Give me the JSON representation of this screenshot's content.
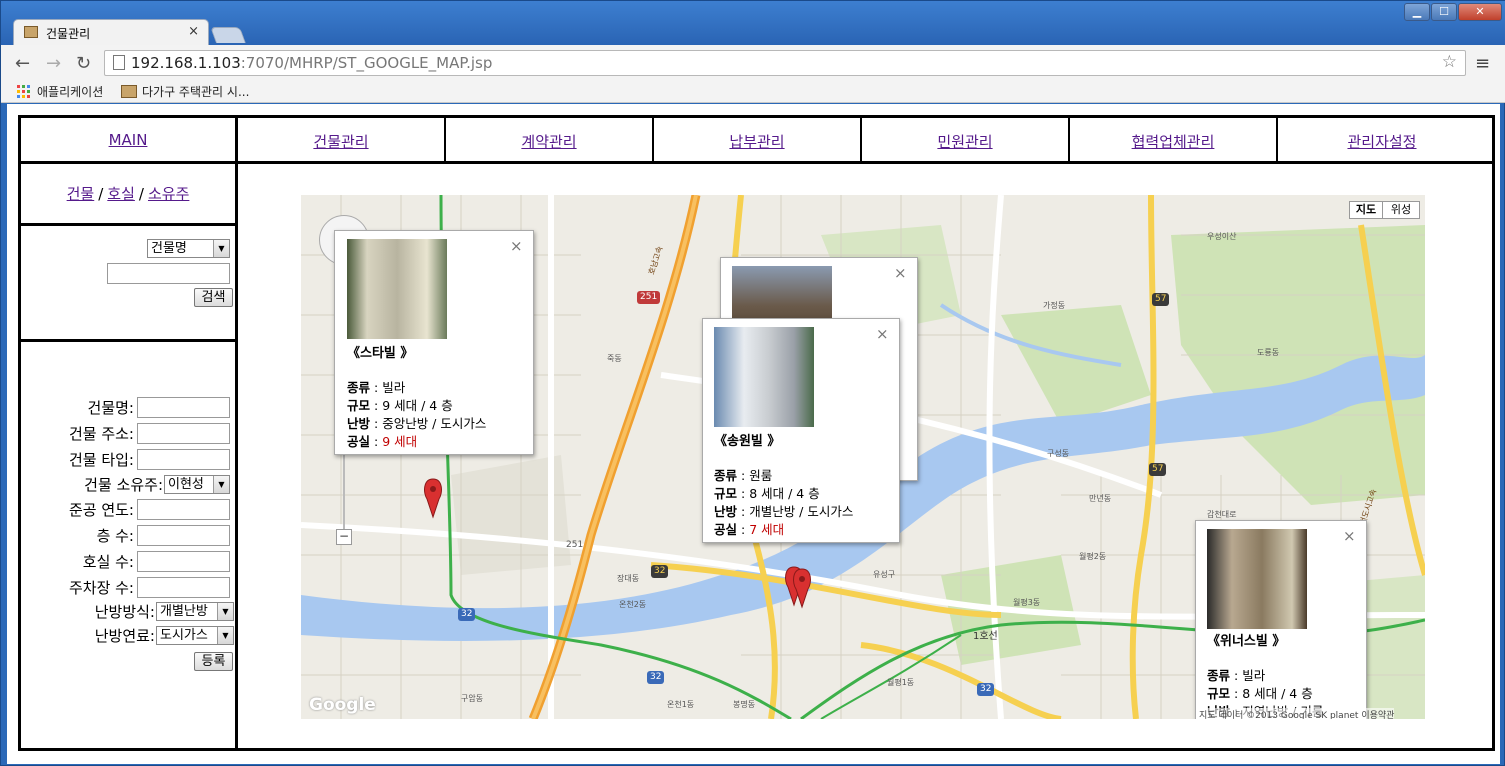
{
  "browser": {
    "tab_title": "건물관리",
    "tab_close": "×",
    "url_host": "192.168.1.103",
    "url_rest": ":7070/MHRP/ST_GOOGLE_MAP.jsp",
    "bookmarks": [
      "애플리케이션",
      "다가구 주택관리 시..."
    ]
  },
  "nav": {
    "main": "MAIN",
    "items": [
      "건물관리",
      "계약관리",
      "납부관리",
      "민원관리",
      "협력업체관리",
      "관리자설정"
    ]
  },
  "left": {
    "links": [
      "건물",
      "호실",
      "소유주"
    ],
    "sep": "/",
    "search": {
      "select_value": "건물명",
      "input_value": "",
      "button": "검색"
    },
    "form": {
      "fields": [
        {
          "label": "건물명:",
          "value": ""
        },
        {
          "label": "건물 주소:",
          "value": ""
        },
        {
          "label": "건물 타입:",
          "value": ""
        },
        {
          "label": "건물 소유주:",
          "value": "이현성",
          "type": "select"
        },
        {
          "label": "준공 연도:",
          "value": ""
        },
        {
          "label": "층 수:",
          "value": ""
        },
        {
          "label": "호실 수:",
          "value": ""
        },
        {
          "label": "주차장 수:",
          "value": ""
        },
        {
          "label": "난방방식:",
          "value": "개별난방",
          "type": "select"
        },
        {
          "label": "난방연료:",
          "value": "도시가스",
          "type": "select"
        }
      ],
      "submit": "등록"
    }
  },
  "map": {
    "map_type": [
      "지도",
      "위성"
    ],
    "logo": "Google",
    "attribution": "지도 데이터 ©2013 Google SK planet  이용약관",
    "labels": [
      "우성이산",
      "가정동",
      "도룡동",
      "죽동",
      "구성동",
      "만년동",
      "월평2동",
      "월평3동",
      "유성구",
      "온천2동",
      "장대동",
      "구암동",
      "온천1동",
      "봉명동",
      "월평1동",
      "갑천대로",
      "1호선",
      "호남고속",
      "갈천도시고속"
    ],
    "shields": [
      "251",
      "57",
      "57",
      "32",
      "32",
      "32",
      "32",
      "251"
    ],
    "info_windows": [
      {
        "name": "《스타빌 》",
        "kind_label": "종류",
        "kind": "빌라",
        "size_label": "규모",
        "size": "9 세대 / 4 층",
        "heat_label": "난방",
        "heat": "중앙난방 / 도시가스",
        "vacant_label": "공실",
        "vacant": "9 세대"
      },
      {
        "name": "《송원빌 》",
        "kind_label": "종류",
        "kind": "원룸",
        "size_label": "규모",
        "size": "8 세대 / 4 층",
        "heat_label": "난방",
        "heat": "개별난방 / 도시가스",
        "vacant_label": "공실",
        "vacant": "7 세대"
      },
      {
        "name": "《위너스빌 》",
        "kind_label": "종류",
        "kind": "빌라",
        "size_label": "규모",
        "size": "8 세대 / 4 층",
        "heat_label": "난방",
        "heat": "지역난방 / 기름"
      }
    ],
    "close": "×",
    "colon": " : ",
    "zoom_in": "+",
    "zoom_out": "−"
  },
  "colors": {
    "link": "#551a8b",
    "vacant": "#c00000",
    "marker": "#d93030",
    "highway": "#f0a030",
    "subway": "#3db04a",
    "river": "#a8c8f0"
  }
}
